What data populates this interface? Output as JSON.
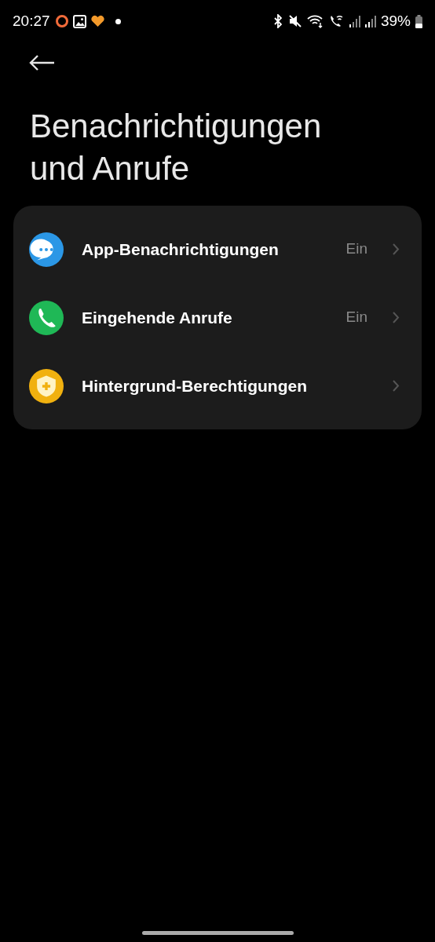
{
  "status_bar": {
    "time": "20:27",
    "battery": "39%"
  },
  "title": "Benachrichtigungen und Anrufe",
  "items": [
    {
      "kind": "chat",
      "color": "#2b97e6",
      "label": "App-Benachrichtigungen",
      "value": "Ein"
    },
    {
      "kind": "phone",
      "color": "#1fb856",
      "label": "Eingehende Anrufe",
      "value": "Ein"
    },
    {
      "kind": "shield",
      "color": "#f1b10f",
      "label": "Hintergrund-Berechtigungen"
    }
  ]
}
